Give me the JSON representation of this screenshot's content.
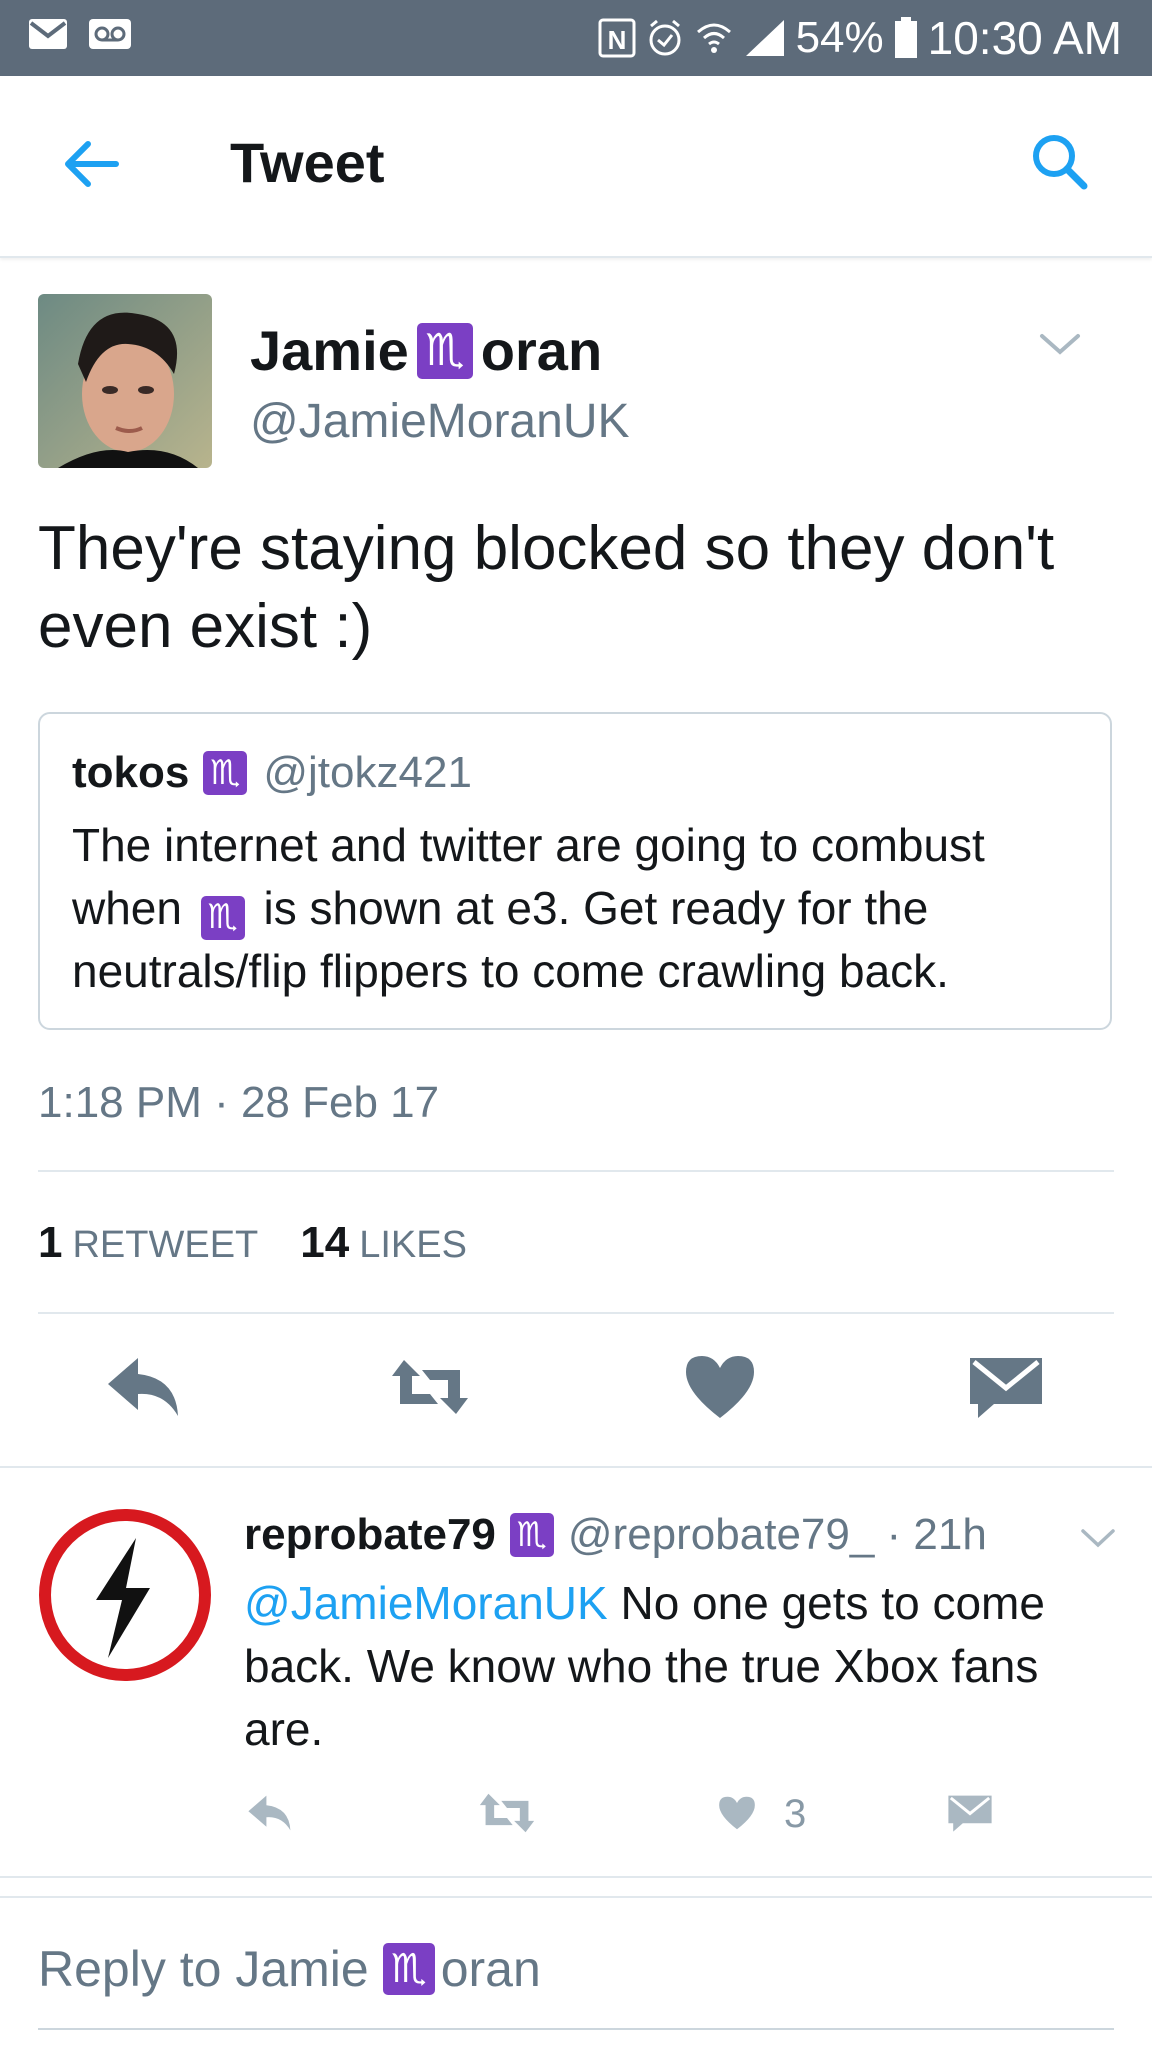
{
  "status_bar": {
    "battery": "54%",
    "time": "10:30 AM",
    "icons": [
      "mail-icon",
      "voicemail-icon",
      "nfc-icon",
      "alarm-icon",
      "wifi-icon",
      "signal-icon",
      "battery-icon"
    ]
  },
  "header": {
    "title": "Tweet",
    "back_icon": "arrow-left-icon",
    "search_icon": "search-icon"
  },
  "tweet": {
    "author_name_prefix": "Jamie",
    "author_name_glyph": "♏",
    "author_name_suffix": "oran",
    "handle": "@JamieMoranUK",
    "text": "They're staying blocked so they don't even exist :)",
    "quote": {
      "name": "tokos",
      "glyph": "♏",
      "handle": "@jtokz421",
      "text_part1": "The internet and twitter are going to combust when",
      "glyph_inline": "♏",
      "text_part2": "is shown at e3. Get ready for the neutrals/flip flippers to come crawling back."
    },
    "timestamp": "1:18 PM · 28 Feb 17",
    "retweets_count": "1",
    "retweets_label": "RETWEET",
    "likes_count": "14",
    "likes_label": "LIKES"
  },
  "reply": {
    "name": "reprobate79",
    "glyph": "♏",
    "handle_time": "@reprobate79_ · 21h",
    "mention": "@JamieMoranUK",
    "text": "No one gets to come back. We know who the true Xbox fans are.",
    "like_count": "3"
  },
  "compose": {
    "prefix": "Reply to Jamie",
    "glyph": "♏",
    "suffix": "oran"
  },
  "colors": {
    "accent": "#1da1f2",
    "status_bar": "#5d6b7a",
    "glyph_bg": "#7b3fc4",
    "muted": "#657786"
  }
}
